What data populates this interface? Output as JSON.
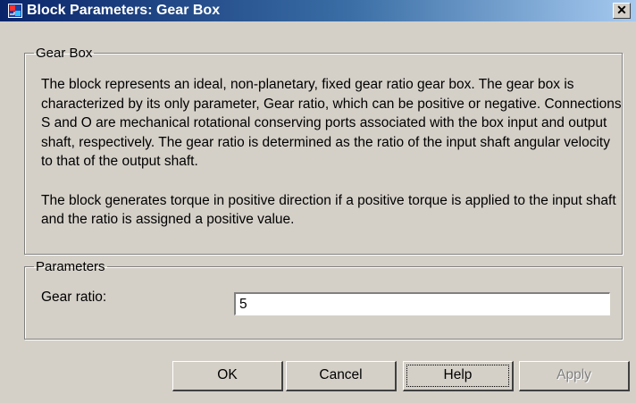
{
  "window": {
    "title": "Block Parameters: Gear Box",
    "icon": "simulink-block-icon",
    "close_glyph": "✕"
  },
  "gearbox_group": {
    "legend": "Gear Box",
    "paragraph_1": "The block represents an ideal, non-planetary, fixed gear ratio gear box. The gear box is characterized by its only parameter, Gear ratio, which can be positive or negative. Connections S and O are mechanical rotational conserving ports associated with the box input and output shaft, respectively. The gear ratio is determined as the ratio of the input shaft angular velocity to that of the output shaft.",
    "paragraph_2": "The block generates torque in positive direction if a positive torque is applied to the input shaft and the ratio is assigned a positive value."
  },
  "params_group": {
    "legend": "Parameters",
    "gear_ratio_label": "Gear ratio:",
    "gear_ratio_value": "5"
  },
  "buttons": {
    "ok": "OK",
    "cancel": "Cancel",
    "help": "Help",
    "apply": "Apply"
  },
  "colors": {
    "titlebar_start": "#0a246a",
    "titlebar_end": "#a6caf0",
    "dialog_bg": "#d4d0c8"
  }
}
